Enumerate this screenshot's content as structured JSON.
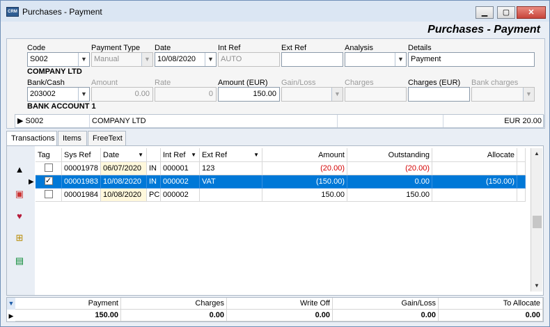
{
  "window": {
    "title": "Purchases - Payment",
    "heading": "Purchases - Payment",
    "minimize": "▁",
    "maximize": "▢",
    "close": "✕"
  },
  "form": {
    "labels": {
      "code": "Code",
      "payment_type": "Payment Type",
      "date": "Date",
      "int_ref": "Int Ref",
      "ext_ref": "Ext Ref",
      "analysis": "Analysis",
      "details": "Details",
      "bank_cash": "Bank/Cash",
      "amount": "Amount",
      "rate": "Rate",
      "amount_eur": "Amount (EUR)",
      "gain_loss": "Gain/Loss",
      "charges": "Charges",
      "charges_eur": "Charges (EUR)",
      "bank_charges": "Bank charges"
    },
    "code": "S002",
    "payment_type": "Manual",
    "date": "10/08/2020",
    "int_ref": "AUTO",
    "ext_ref": "",
    "analysis": "",
    "details": "Payment",
    "company_name": "COMPANY LTD",
    "bank_cash": "203002",
    "amount": "0.00",
    "rate": "0",
    "amount_eur": "150.00",
    "gain_loss": "",
    "charges": "",
    "charges_eur": "",
    "bank_charges": "",
    "bank_account_name": "BANK ACCOUNT 1",
    "summary": {
      "code": "S002",
      "name": "COMPANY LTD",
      "blank": "",
      "currency_total": "EUR 20.00"
    }
  },
  "tabs": [
    "Transactions",
    "Items",
    "FreeText"
  ],
  "grid": {
    "headers": {
      "tag": "Tag",
      "sys_ref": "Sys Ref",
      "date": "Date",
      "type": "",
      "int_ref": "Int Ref",
      "ext_ref": "Ext Ref",
      "amount": "Amount",
      "outstanding": "Outstanding",
      "allocate": "Allocate"
    },
    "rows": [
      {
        "tag": "",
        "sys_ref": "00001978",
        "date": "06/07/2020",
        "type": "IN",
        "int_ref": "000001",
        "ext_ref": "123",
        "amount": "(20.00)",
        "outstanding": "(20.00)",
        "allocate": ""
      },
      {
        "tag": "✓",
        "sys_ref": "00001983",
        "date": "10/08/2020",
        "type": "IN",
        "int_ref": "000002",
        "ext_ref": "VAT",
        "amount": "(150.00)",
        "outstanding": "0.00",
        "allocate": "(150.00)"
      },
      {
        "tag": "",
        "sys_ref": "00001984",
        "date": "10/08/2020",
        "type": "PC",
        "int_ref": "000002",
        "ext_ref": "",
        "amount": "150.00",
        "outstanding": "150.00",
        "allocate": ""
      }
    ],
    "row_selector": "▶"
  },
  "footer": {
    "headers": [
      "Payment",
      "Charges",
      "Write Off",
      "Gain/Loss",
      "To Allocate"
    ],
    "values": [
      "150.00",
      "0.00",
      "0.00",
      "0.00",
      "0.00"
    ],
    "expand_marker": "▼",
    "row_marker": "▶"
  },
  "icons": {
    "app": "CRM",
    "up": "▲",
    "tool1": "▣",
    "tool2": "♥",
    "tool3": "⊞",
    "tool4": "▤",
    "sort": "▼",
    "combo": "▼",
    "scroll_up": "▲",
    "scroll_down": "▼"
  },
  "colors": {
    "selection": "#0078d7",
    "negative": "#d40000",
    "date_highlight": "#fff8dc"
  }
}
